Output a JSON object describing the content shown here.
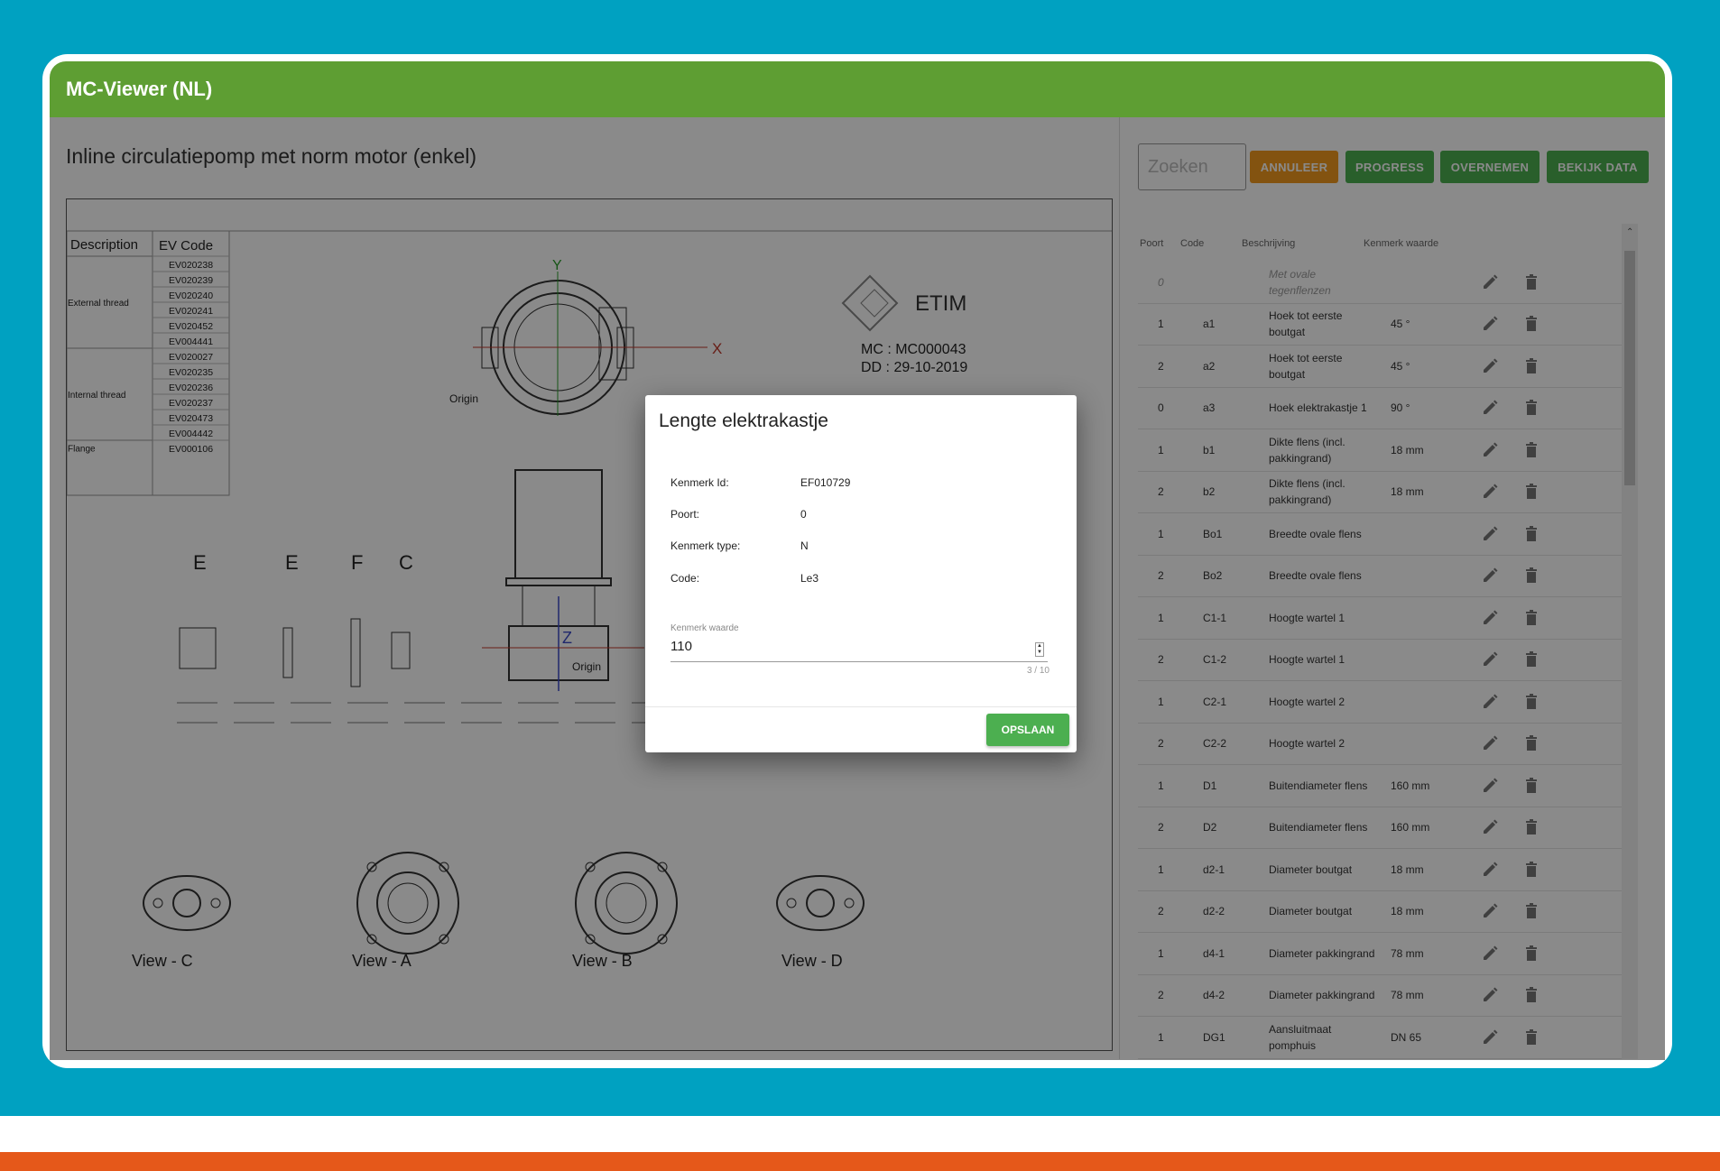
{
  "app": {
    "title": "MC-Viewer (NL)"
  },
  "page": {
    "title": "Inline circulatiepomp met norm motor (enkel)"
  },
  "drawing": {
    "table_headers": [
      "Description",
      "EV Code"
    ],
    "groups": [
      {
        "label": "External thread",
        "codes": [
          "EV020238",
          "EV020239",
          "EV020240",
          "EV020241",
          "EV020452",
          "EV004441"
        ]
      },
      {
        "label": "Internal thread",
        "codes": [
          "EV020027",
          "EV020235",
          "EV020236",
          "EV020237",
          "EV020473",
          "EV004442"
        ]
      },
      {
        "label": "Flange",
        "codes": [
          "EV000106"
        ]
      }
    ],
    "etim": "ETIM",
    "mc_label": "MC : MC000043",
    "dd_label": "DD : 29-10-2019",
    "axis_y": "Y",
    "axis_x": "X",
    "axis_z": "Z",
    "origin": "Origin",
    "section_letters": [
      "E",
      "E",
      "F",
      "C"
    ],
    "views": [
      "View - C",
      "View - A",
      "View - B",
      "View - D"
    ]
  },
  "search": {
    "placeholder": "Zoeken"
  },
  "buttons": {
    "annuleer": "ANNULEER",
    "progress": "PROGRESS",
    "overnemen": "OVERNEMEN",
    "bekijk_data": "BEKIJK DATA"
  },
  "table": {
    "headers": {
      "poort": "Poort",
      "code": "Code",
      "beschrijving": "Beschrijving",
      "kenmerk_waarde": "Kenmerk waarde"
    },
    "rows": [
      {
        "poort": "0",
        "code": "",
        "desc": "Met ovale tegenflenzen",
        "val": ""
      },
      {
        "poort": "1",
        "code": "a1",
        "desc": "Hoek tot eerste boutgat",
        "val": "45 °"
      },
      {
        "poort": "2",
        "code": "a2",
        "desc": "Hoek tot eerste boutgat",
        "val": "45 °"
      },
      {
        "poort": "0",
        "code": "a3",
        "desc": "Hoek elektrakastje 1",
        "val": "90 °"
      },
      {
        "poort": "1",
        "code": "b1",
        "desc": "Dikte flens (incl. pakkingrand)",
        "val": "18 mm"
      },
      {
        "poort": "2",
        "code": "b2",
        "desc": "Dikte flens (incl. pakkingrand)",
        "val": "18 mm"
      },
      {
        "poort": "1",
        "code": "Bo1",
        "desc": "Breedte ovale flens",
        "val": ""
      },
      {
        "poort": "2",
        "code": "Bo2",
        "desc": "Breedte ovale flens",
        "val": ""
      },
      {
        "poort": "1",
        "code": "C1-1",
        "desc": "Hoogte wartel 1",
        "val": ""
      },
      {
        "poort": "2",
        "code": "C1-2",
        "desc": "Hoogte wartel 1",
        "val": ""
      },
      {
        "poort": "1",
        "code": "C2-1",
        "desc": "Hoogte wartel 2",
        "val": ""
      },
      {
        "poort": "2",
        "code": "C2-2",
        "desc": "Hoogte wartel 2",
        "val": ""
      },
      {
        "poort": "1",
        "code": "D1",
        "desc": "Buitendiameter flens",
        "val": "160 mm"
      },
      {
        "poort": "2",
        "code": "D2",
        "desc": "Buitendiameter flens",
        "val": "160 mm"
      },
      {
        "poort": "1",
        "code": "d2-1",
        "desc": "Diameter boutgat",
        "val": "18 mm"
      },
      {
        "poort": "2",
        "code": "d2-2",
        "desc": "Diameter boutgat",
        "val": "18 mm"
      },
      {
        "poort": "1",
        "code": "d4-1",
        "desc": "Diameter pakkingrand",
        "val": "78 mm"
      },
      {
        "poort": "2",
        "code": "d4-2",
        "desc": "Diameter pakkingrand",
        "val": "78 mm"
      },
      {
        "poort": "1",
        "code": "DG1",
        "desc": "Aansluitmaat pomphuis",
        "val": "DN 65"
      }
    ]
  },
  "dialog": {
    "title": "Lengte elektrakastje",
    "fields": [
      {
        "label": "Kenmerk Id:",
        "value": "EF010729"
      },
      {
        "label": "Poort:",
        "value": "0"
      },
      {
        "label": "Kenmerk type:",
        "value": "N"
      },
      {
        "label": "Code:",
        "value": "Le3"
      }
    ],
    "input_label": "Kenmerk waarde",
    "input_value": "110",
    "counter": "3 / 10",
    "save": "OPSLAAN"
  },
  "colors": {
    "header_green": "#5e9e33",
    "button_green": "#4caf50",
    "button_orange": "#f39a1f",
    "frame_teal": "#00a1c1",
    "bottom_orange": "#e5581a"
  },
  "icons": {
    "edit": "pencil-icon",
    "delete": "trash-icon"
  }
}
